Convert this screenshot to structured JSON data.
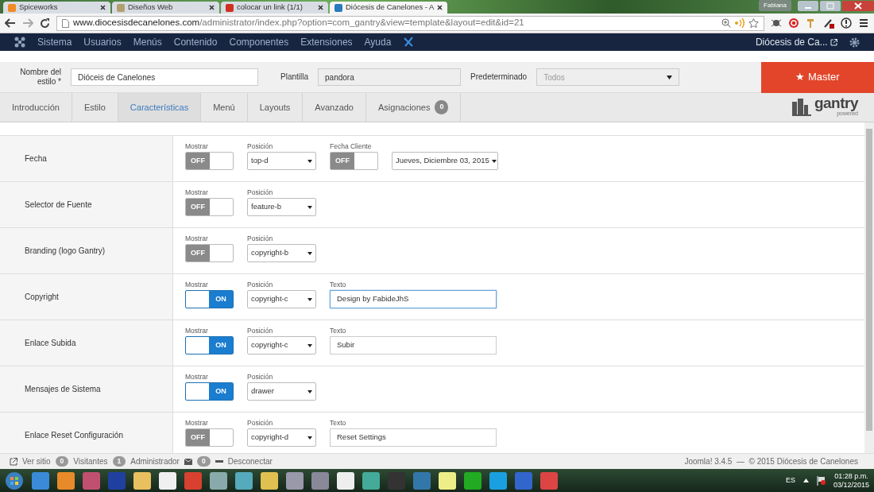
{
  "browser": {
    "user": "Fabiana",
    "tabs": [
      {
        "title": "Spiceworks",
        "selected": false
      },
      {
        "title": "Diseños Web",
        "selected": false
      },
      {
        "title": "colocar un link (1/1)",
        "selected": false
      },
      {
        "title": "Diócesis de Canelones - A",
        "selected": true
      }
    ],
    "url": {
      "host": "www.diocesisdecanelones.com",
      "path": "/administrator/index.php?option=com_gantry&view=template&layout=edit&id=21"
    }
  },
  "admin_nav": {
    "items": [
      "Sistema",
      "Usuarios",
      "Menús",
      "Contenido",
      "Componentes",
      "Extensiones",
      "Ayuda"
    ],
    "site_name": "Diócesis de Ca..."
  },
  "style_form": {
    "name_label": "Nombre del estilo *",
    "name_value": "Dióceis de Canelones",
    "template_label": "Plantilla",
    "template_value": "pandora",
    "default_label": "Predeterminado",
    "default_value": "Todos",
    "master_button": "★ Master"
  },
  "tabs": [
    {
      "label": "Introducción",
      "selected": false
    },
    {
      "label": "Estilo",
      "selected": false
    },
    {
      "label": "Características",
      "selected": true
    },
    {
      "label": "Menú",
      "selected": false
    },
    {
      "label": "Layouts",
      "selected": false
    },
    {
      "label": "Avanzado",
      "selected": false
    },
    {
      "label": "Asignaciones",
      "selected": false,
      "badge": "0"
    }
  ],
  "brand": {
    "name": "gantry",
    "sub": "powered"
  },
  "rows": [
    {
      "label": "Fecha",
      "fields": [
        {
          "kind": "toggle",
          "label": "Mostrar",
          "on": false,
          "text": "OFF"
        },
        {
          "kind": "select",
          "label": "Posición",
          "value": "top-d"
        },
        {
          "kind": "toggle",
          "label": "Fecha Cliente",
          "on": false,
          "text": "OFF"
        },
        {
          "kind": "date_select",
          "value": "Jueves, Diciembre 03, 2015"
        }
      ]
    },
    {
      "label": "Selector de Fuente",
      "fields": [
        {
          "kind": "toggle",
          "label": "Mostrar",
          "on": false,
          "text": "OFF"
        },
        {
          "kind": "select",
          "label": "Posición",
          "value": "feature-b"
        }
      ]
    },
    {
      "label": "Branding (logo Gantry)",
      "fields": [
        {
          "kind": "toggle",
          "label": "Mostrar",
          "on": false,
          "text": "OFF"
        },
        {
          "kind": "select",
          "label": "Posición",
          "value": "copyright-b"
        }
      ]
    },
    {
      "label": "Copyright",
      "fields": [
        {
          "kind": "toggle",
          "label": "Mostrar",
          "on": true,
          "text": "ON"
        },
        {
          "kind": "select",
          "label": "Posición",
          "value": "copyright-c"
        },
        {
          "kind": "text",
          "label": "Texto",
          "value": "Design by FabideJhS",
          "focused": true
        }
      ]
    },
    {
      "label": "Enlace Subida",
      "fields": [
        {
          "kind": "toggle",
          "label": "Mostrar",
          "on": true,
          "text": "ON"
        },
        {
          "kind": "select",
          "label": "Posición",
          "value": "copyright-c"
        },
        {
          "kind": "text",
          "label": "Texto",
          "value": "Subir",
          "focused": false
        }
      ]
    },
    {
      "label": "Mensajes de Sistema",
      "fields": [
        {
          "kind": "toggle",
          "label": "Mostrar",
          "on": true,
          "text": "ON"
        },
        {
          "kind": "select",
          "label": "Posición",
          "value": "drawer"
        }
      ]
    },
    {
      "label": "Enlace Reset Configuración",
      "fields": [
        {
          "kind": "toggle",
          "label": "Mostrar",
          "on": false,
          "text": "OFF"
        },
        {
          "kind": "select",
          "label": "Posición",
          "value": "copyright-d"
        },
        {
          "kind": "text",
          "label": "Texto",
          "value": "Reset Settings",
          "focused": false
        }
      ]
    }
  ],
  "status_bar": {
    "items": [
      {
        "kind": "link",
        "text": "Ver sitio"
      },
      {
        "kind": "count",
        "count": "0",
        "text": "Visitantes"
      },
      {
        "kind": "count",
        "count": "1",
        "text": "Administrador"
      },
      {
        "kind": "mail",
        "count": "0"
      },
      {
        "kind": "logout",
        "text": "Desconectar"
      }
    ],
    "footer": "Joomla! 3.4.5  —  © 2015 Diócesis de Canelones"
  },
  "taskbar": {
    "language": "ES",
    "time": "01:28 p.m.",
    "date": "03/12/2015"
  }
}
